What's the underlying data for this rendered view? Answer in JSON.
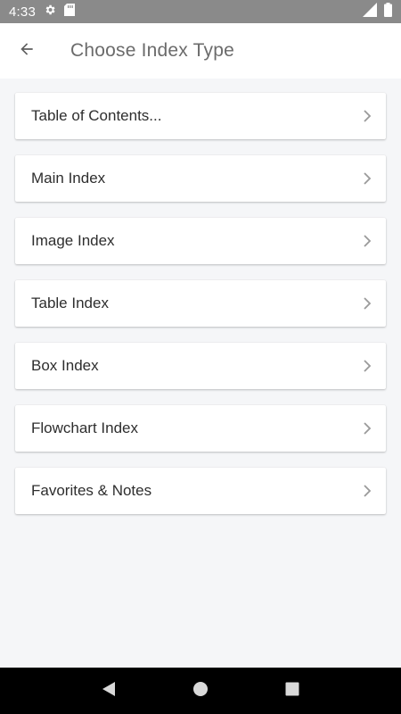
{
  "status_bar": {
    "time": "4:33",
    "icons": [
      "settings-icon",
      "sd-card-icon",
      "signal-icon",
      "battery-icon"
    ]
  },
  "app_bar": {
    "title": "Choose Index Type",
    "back_icon": "arrow-back-icon"
  },
  "index_types": [
    {
      "label": "Table of Contents..."
    },
    {
      "label": "Main Index"
    },
    {
      "label": "Image Index"
    },
    {
      "label": "Table Index"
    },
    {
      "label": "Box Index"
    },
    {
      "label": "Flowchart Index"
    },
    {
      "label": "Favorites & Notes"
    }
  ],
  "nav_bar": {
    "icons": [
      "back-triangle-icon",
      "home-circle-icon",
      "recents-square-icon"
    ]
  },
  "colors": {
    "status_bar_bg": "#8a8a8a",
    "app_bar_bg": "#ffffff",
    "content_bg": "#f5f6f8",
    "title_text": "#6b6b6b",
    "item_text": "#2e2e2e",
    "chevron": "#9a9a9a",
    "nav_bar_bg": "#000000"
  }
}
